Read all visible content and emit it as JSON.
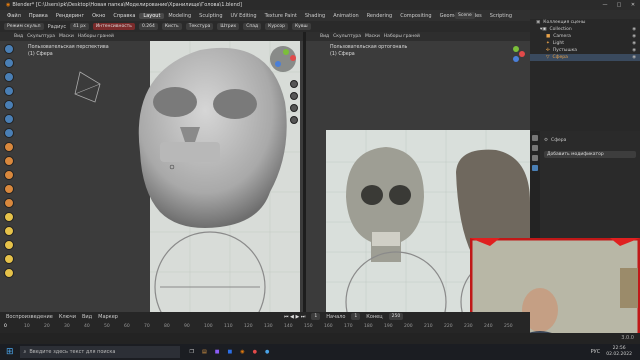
{
  "titlebar": {
    "title": "Blender* [C:\\Users\\pk\\Desktop\\Новая папка\\Моделирование\\Хранилище\\Голова\\1.blend]",
    "min": "—",
    "max": "□",
    "close": "✕"
  },
  "menu": {
    "items": [
      "Файл",
      "Правка",
      "Рендеринг",
      "Окно",
      "Справка"
    ],
    "workspaces": [
      "Layout",
      "Modeling",
      "Sculpting",
      "UV Editing",
      "Texture Paint",
      "Shading",
      "Animation",
      "Rendering",
      "Compositing",
      "Geometry Nodes",
      "Scripting"
    ],
    "active_workspace": "Layout",
    "scene": "Scene",
    "view_layer": "View Layer"
  },
  "toolopts": {
    "mode": "Режим скульп",
    "radius_label": "Радиус",
    "radius_value": "41 px",
    "strength_label": "Интенсивность",
    "strength_value": "0.264",
    "items": [
      "Кисть",
      "Текстура",
      "Штрих",
      "Спад",
      "Курсор"
    ],
    "symmetry": "Кувш"
  },
  "left_view": {
    "menu": [
      "Вид",
      "Скульптура",
      "Маски",
      "Наборы граней"
    ],
    "view_name": "Пользовательская перспектива",
    "object": "(1) Сфера"
  },
  "right_view": {
    "menu": [
      "Вид",
      "Скульптура",
      "Маски",
      "Наборы граней"
    ],
    "view_name": "Пользовательская ортогональ",
    "object": "(1) Сфера"
  },
  "outliner": {
    "header": "Коллекция сцены",
    "items": [
      {
        "label": "Collection",
        "depth": 1
      },
      {
        "label": "Camera",
        "depth": 2
      },
      {
        "label": "Light",
        "depth": 2
      },
      {
        "label": "Пустышка",
        "depth": 2
      },
      {
        "label": "Сфера",
        "depth": 2,
        "selected": true
      }
    ]
  },
  "properties": {
    "object": "Сфера",
    "add_modifier": "Добавить модификатор"
  },
  "timeline": {
    "playback": "Воспроизведение",
    "keying": "Ключи",
    "view": "Вид",
    "marker": "Маркер",
    "frame": "1",
    "start_label": "Начало",
    "start": "1",
    "end_label": "Конец",
    "end": "250",
    "ticks": [
      "0",
      "10",
      "20",
      "30",
      "40",
      "50",
      "60",
      "70",
      "80",
      "90",
      "100",
      "110",
      "120",
      "130",
      "140",
      "150",
      "160",
      "170",
      "180",
      "190",
      "200",
      "210",
      "220",
      "230",
      "240",
      "250"
    ]
  },
  "status": {
    "version": "3.0.0"
  },
  "taskbar": {
    "search_placeholder": "Введите здесь текст для поиска",
    "lang": "РУС",
    "time": "22:56",
    "date": "02.02.2022"
  },
  "colors": {
    "accent": "#e06a1b",
    "selected": "#e8a24a",
    "tool_orange": "#d9883d",
    "tool_blue": "#4a7fb5"
  }
}
